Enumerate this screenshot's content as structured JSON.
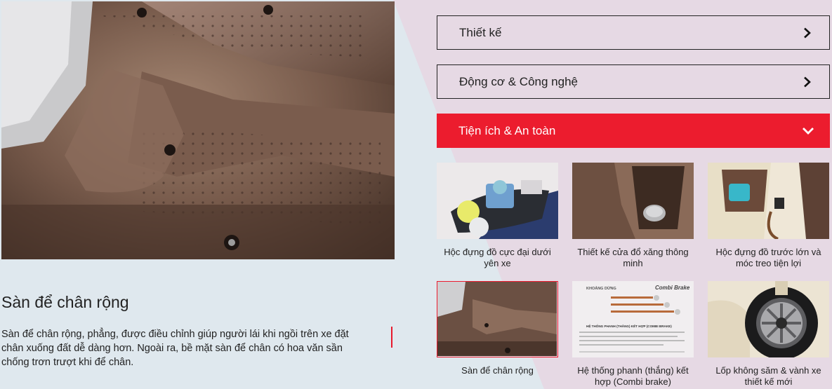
{
  "accordion": [
    {
      "label": "Thiết kế",
      "state": "collapsed",
      "icon": "chevron-right-icon"
    },
    {
      "label": "Động cơ & Công nghệ",
      "state": "collapsed",
      "icon": "chevron-right-icon"
    },
    {
      "label": "Tiện ích & An toàn",
      "state": "expanded",
      "icon": "chevron-down-icon"
    }
  ],
  "detail": {
    "title": "Sàn để chân rộng",
    "description": "Sàn để chân rộng, phẳng, được điều chỉnh giúp người lái khi ngồi trên xe đặt chân xuống đất dễ dàng hơn. Ngoài ra, bề mặt sàn để chân có hoa văn sần chống trơn trượt khi để chân."
  },
  "features": [
    {
      "caption": "Hộc đựng đồ cực đại dưới yên xe"
    },
    {
      "caption": "Thiết kế cửa đổ xăng thông minh"
    },
    {
      "caption": "Hộc đựng đồ trước lớn và móc treo tiện lợi"
    },
    {
      "caption": "Sàn để chân rộng",
      "selected": true
    },
    {
      "caption": "Hệ thống phanh (thắng) kết hợp (Combi brake)"
    },
    {
      "caption": "Lốp không săm & vành xe thiết kế mới"
    }
  ],
  "combi_image_text": {
    "brand": "Combi Brake",
    "heading1": "KHOẢNG DỪNG",
    "heading2": "HỆ THỐNG PHANH (THẮNG) KẾT HỢP (COMBI BRAKE)"
  },
  "colors": {
    "accent": "#ec1c2e",
    "text": "#222222"
  }
}
